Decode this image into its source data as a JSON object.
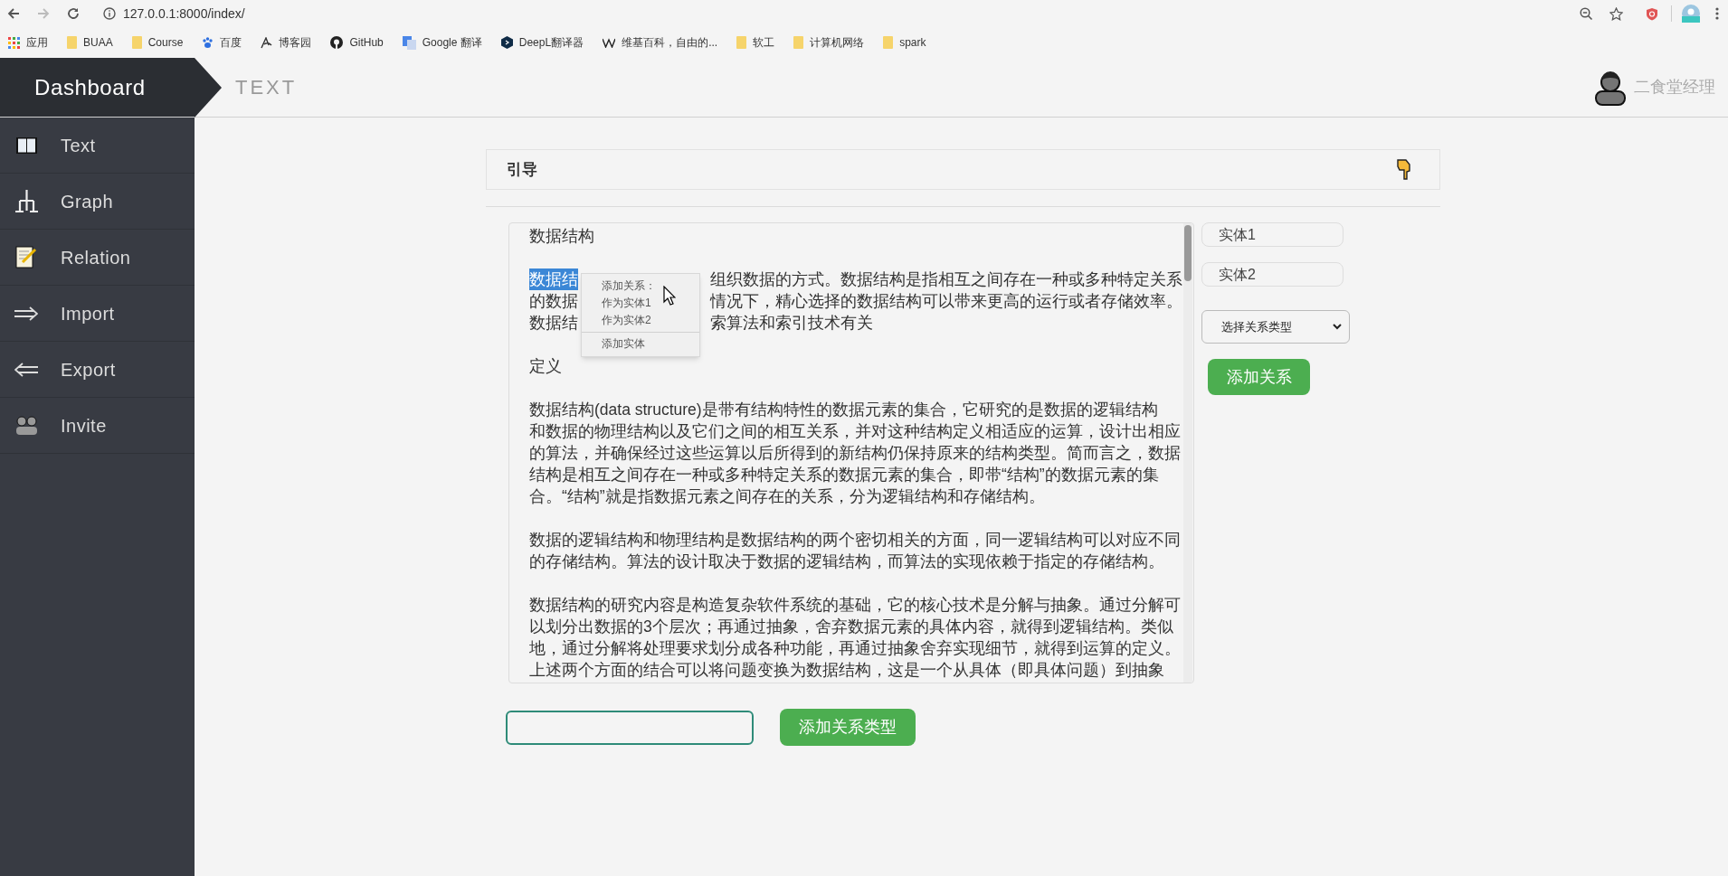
{
  "browser": {
    "url": "127.0.0.1:8000/index/",
    "bookmarks": [
      {
        "label": "应用",
        "kind": "apps"
      },
      {
        "label": "BUAA",
        "kind": "folder"
      },
      {
        "label": "Course",
        "kind": "folder"
      },
      {
        "label": "百度",
        "kind": "paw"
      },
      {
        "label": "博客园",
        "kind": "blog"
      },
      {
        "label": "GitHub",
        "kind": "github"
      },
      {
        "label": "Google 翻译",
        "kind": "translate"
      },
      {
        "label": "DeepL翻译器",
        "kind": "deepl"
      },
      {
        "label": "维基百科，自由的...",
        "kind": "wiki"
      },
      {
        "label": "软工",
        "kind": "folder"
      },
      {
        "label": "计算机网络",
        "kind": "folder"
      },
      {
        "label": "spark",
        "kind": "folder"
      }
    ]
  },
  "header": {
    "brand": "Dashboard",
    "page_title": "TEXT",
    "user_name": "二食堂经理"
  },
  "sidebar": {
    "items": [
      {
        "label": "Text",
        "kind": "book"
      },
      {
        "label": "Graph",
        "kind": "tree"
      },
      {
        "label": "Relation",
        "kind": "memo"
      },
      {
        "label": "Import",
        "kind": "right_arrow"
      },
      {
        "label": "Export",
        "kind": "left_arrow"
      },
      {
        "label": "Invite",
        "kind": "people"
      }
    ]
  },
  "guide": {
    "title": "引导"
  },
  "document": {
    "lines": [
      {
        "kind": "text",
        "text": "数据结构"
      },
      {
        "kind": "blank"
      },
      {
        "kind": "split",
        "left": "数据结",
        "right": "组织数据的方式。数据结构是指相互之间存在一种或多种特定关系",
        "selected": true
      },
      {
        "kind": "split",
        "left": "的数据",
        "right": "情况下，精心选择的数据结构可以带来更高的运行或者存储效率。",
        "selected": false
      },
      {
        "kind": "split",
        "left": "数据结",
        "right": "索算法和索引技术有关",
        "selected": false
      },
      {
        "kind": "blank"
      },
      {
        "kind": "text",
        "text": "定义"
      },
      {
        "kind": "blank"
      },
      {
        "kind": "text",
        "text": "数据结构(data structure)是带有结构特性的数据元素的集合，它研究的是数据的逻辑结构"
      },
      {
        "kind": "text",
        "text": "和数据的物理结构以及它们之间的相互关系，并对这种结构定义相适应的运算，设计出相应"
      },
      {
        "kind": "text",
        "text": "的算法，并确保经过这些运算以后所得到的新结构仍保持原来的结构类型。简而言之，数据"
      },
      {
        "kind": "text",
        "text": "结构是相互之间存在一种或多种特定关系的数据元素的集合，即带“结构”的数据元素的集"
      },
      {
        "kind": "text",
        "text": "合。“结构”就是指数据元素之间存在的关系，分为逻辑结构和存储结构。"
      },
      {
        "kind": "blank"
      },
      {
        "kind": "text",
        "text": "数据的逻辑结构和物理结构是数据结构的两个密切相关的方面，同一逻辑结构可以对应不同"
      },
      {
        "kind": "text",
        "text": "的存储结构。算法的设计取决于数据的逻辑结构，而算法的实现依赖于指定的存储结构。"
      },
      {
        "kind": "blank"
      },
      {
        "kind": "text",
        "text": "数据结构的研究内容是构造复杂软件系统的基础，它的核心技术是分解与抽象。通过分解可"
      },
      {
        "kind": "text",
        "text": "以划分出数据的3个层次；再通过抽象，舍弃数据元素的具体内容，就得到逻辑结构。类似"
      },
      {
        "kind": "text",
        "text": "地，通过分解将处理要求划分成各种功能，再通过抽象舍弃实现细节，就得到运算的定义。"
      },
      {
        "kind": "text",
        "text": "上述两个方面的结合可以将问题变换为数据结构，这是一个从具体（即具体问题）到抽象"
      }
    ]
  },
  "context_menu": {
    "items": [
      {
        "label": "添加关系：",
        "separated": false
      },
      {
        "label": "作为实体1",
        "separated": false
      },
      {
        "label": "作为实体2",
        "separated": false
      },
      {
        "label": "添加实体",
        "separated": true
      }
    ]
  },
  "relation_form": {
    "entity_fields": [
      {
        "placeholder": "实体1"
      },
      {
        "placeholder": "实体2"
      }
    ],
    "relation_select": "选择关系类型",
    "add_button": "添加关系"
  },
  "type_form": {
    "add_button": "添加关系类型"
  }
}
